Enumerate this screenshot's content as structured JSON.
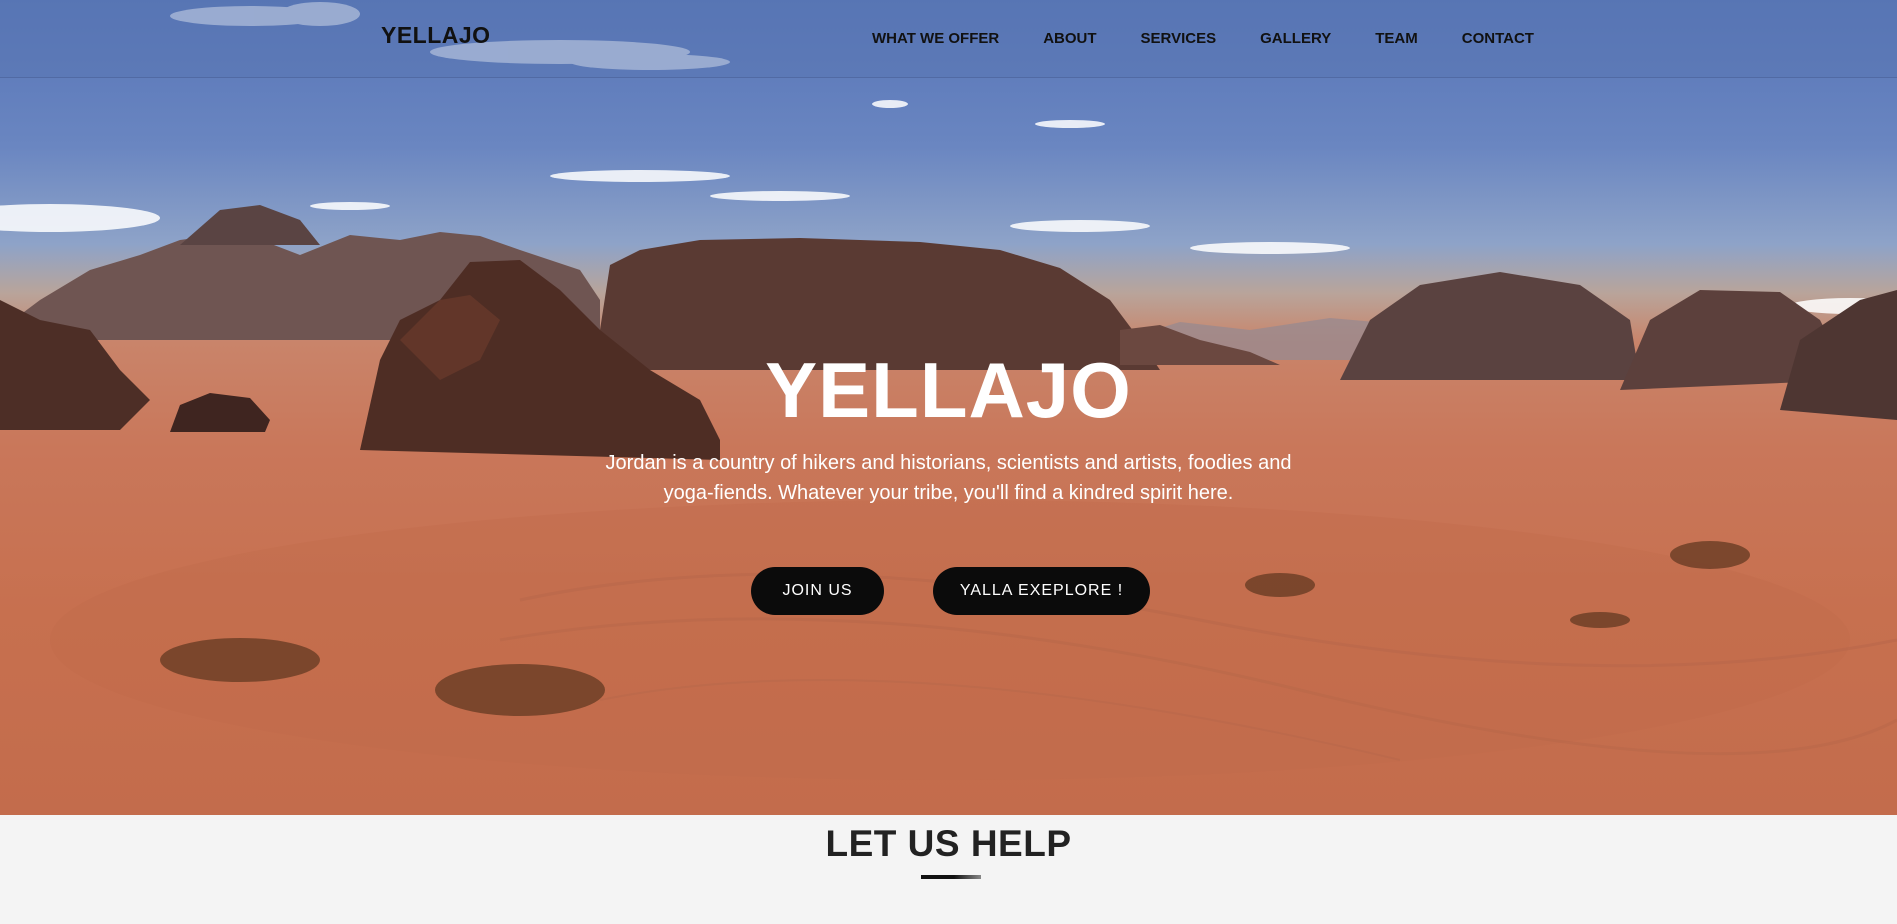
{
  "navbar": {
    "brand": "YELLAJO",
    "links": [
      {
        "label": "WHAT WE OFFER"
      },
      {
        "label": "ABOUT"
      },
      {
        "label": "SERVICES"
      },
      {
        "label": "GALLERY"
      },
      {
        "label": "TEAM"
      },
      {
        "label": "CONTACT"
      }
    ]
  },
  "hero": {
    "title": "YELLAJO",
    "subtitle": "Jordan is a country of hikers and historians, scientists and artists, foodies and yoga-fiends. Whatever your tribe, you'll find a kindred spirit here.",
    "buttons": {
      "join": "JOIN US",
      "explore": "YALLA EXEPLORE !"
    }
  },
  "section": {
    "title": "LET US HELP"
  },
  "colors": {
    "sky": "#5674b7",
    "sand": "#c9775a",
    "rock": "#5a3a30",
    "button_bg": "#0b0b0b",
    "section_bg": "#f4f4f4"
  }
}
